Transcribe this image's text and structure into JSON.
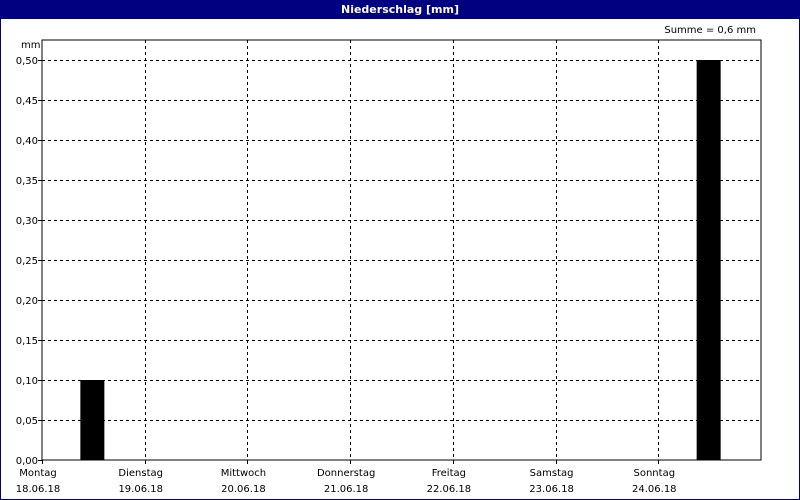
{
  "window": {
    "title": "Niederschlag [mm]"
  },
  "summary": {
    "text": "Summe = 0,6 mm"
  },
  "chart_data": {
    "type": "bar",
    "title": "Niederschlag [mm]",
    "ylabel": "mm",
    "ylim": [
      0,
      0.5
    ],
    "yticks": [
      "0,00",
      "0,05",
      "0,10",
      "0,15",
      "0,20",
      "0,25",
      "0,30",
      "0,35",
      "0,40",
      "0,45",
      "0,50"
    ],
    "categories": [
      {
        "day": "Montag",
        "date": "18.06.18"
      },
      {
        "day": "Dienstag",
        "date": "19.06.18"
      },
      {
        "day": "Mittwoch",
        "date": "20.06.18"
      },
      {
        "day": "Donnerstag",
        "date": "21.06.18"
      },
      {
        "day": "Freitag",
        "date": "22.06.18"
      },
      {
        "day": "Samstag",
        "date": "23.06.18"
      },
      {
        "day": "Sonntag",
        "date": "24.06.18"
      }
    ],
    "values": [
      0.1,
      0,
      0,
      0,
      0,
      0,
      0.5
    ],
    "bar_color": "#000000",
    "grid": true,
    "grid_style": "dashed"
  }
}
